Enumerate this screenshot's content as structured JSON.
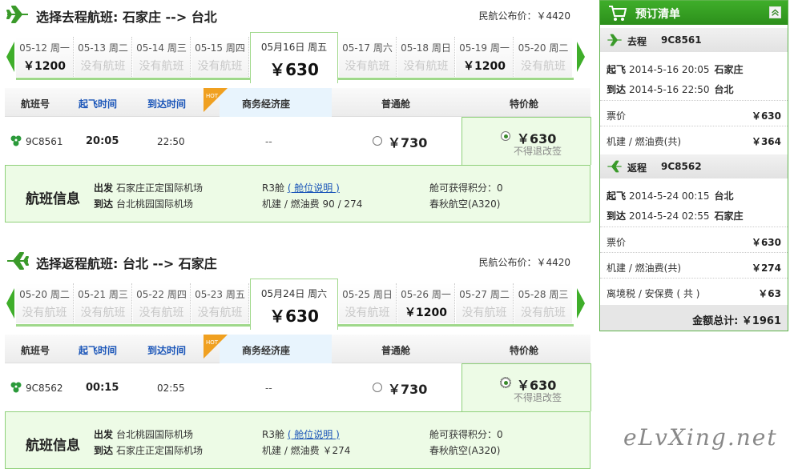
{
  "outbound": {
    "title": "选择去程航班: 石家庄 --> 台北",
    "public_price": "民航公布价：￥4420",
    "dates": [
      {
        "label": "05-12 周一",
        "price": "￥1200",
        "available": true
      },
      {
        "label": "05-13 周二",
        "price": "没有航班",
        "available": false
      },
      {
        "label": "05-14 周三",
        "price": "没有航班",
        "available": false
      },
      {
        "label": "05-15 周四",
        "price": "没有航班",
        "available": false
      },
      {
        "label": "05月16日 周五",
        "price": "￥630",
        "available": true,
        "selected": true
      },
      {
        "label": "05-17 周六",
        "price": "没有航班",
        "available": false
      },
      {
        "label": "05-18 周日",
        "price": "没有航班",
        "available": false
      },
      {
        "label": "05-19 周一",
        "price": "￥1200",
        "available": true
      },
      {
        "label": "05-20 周二",
        "price": "没有航班",
        "available": false
      }
    ],
    "headers": {
      "flight_no": "航班号",
      "dep_time": "起飞时间",
      "arr_time": "到达时间",
      "hot": "HOT",
      "business": "商务经济座",
      "economy": "普通舱",
      "special": "特价舱"
    },
    "flight": {
      "no": "9C8561",
      "dep": "20:05",
      "arr": "22:50",
      "business": "--",
      "economy_price": "￥730",
      "special_price": "￥630",
      "special_note": "不得退改签"
    },
    "info": {
      "title": "航班信息",
      "dep_label": "出发",
      "dep_airport": "石家庄正定国际机场",
      "arr_label": "到达",
      "arr_airport": "台北桃园国际机场",
      "cabin": "R3舱",
      "cabin_link": "( 舱位说明 )",
      "fees": "机建 / 燃油费 90 / 274",
      "points": "舱可获得积分：0",
      "carrier": "春秋航空(A320)"
    }
  },
  "return": {
    "title": "选择返程航班: 台北 --> 石家庄",
    "public_price": "民航公布价：￥4420",
    "dates": [
      {
        "label": "05-20 周二",
        "price": "没有航班",
        "available": false
      },
      {
        "label": "05-21 周三",
        "price": "没有航班",
        "available": false
      },
      {
        "label": "05-22 周四",
        "price": "没有航班",
        "available": false
      },
      {
        "label": "05-23 周五",
        "price": "没有航班",
        "available": false
      },
      {
        "label": "05月24日 周六",
        "price": "￥630",
        "available": true,
        "selected": true
      },
      {
        "label": "05-25 周日",
        "price": "没有航班",
        "available": false
      },
      {
        "label": "05-26 周一",
        "price": "￥1200",
        "available": true
      },
      {
        "label": "05-27 周二",
        "price": "没有航班",
        "available": false
      },
      {
        "label": "05-28 周三",
        "price": "没有航班",
        "available": false
      }
    ],
    "headers": {
      "flight_no": "航班号",
      "dep_time": "起飞时间",
      "arr_time": "到达时间",
      "hot": "HOT",
      "business": "商务经济座",
      "economy": "普通舱",
      "special": "特价舱"
    },
    "flight": {
      "no": "9C8562",
      "dep": "00:15",
      "arr": "02:55",
      "business": "--",
      "economy_price": "￥730",
      "special_price": "￥630",
      "special_note": "不得退改签"
    },
    "info": {
      "title": "航班信息",
      "dep_label": "出发",
      "dep_airport": "台北桃园国际机场",
      "arr_label": "到达",
      "arr_airport": "石家庄正定国际机场",
      "cabin": "R3舱",
      "cabin_link": "( 舱位说明 )",
      "fees": "机建 / 燃油费 ￥274",
      "points": "舱可获得积分：0",
      "carrier": "春秋航空(A320)"
    }
  },
  "sidebar": {
    "title": "预订清单",
    "go": {
      "label": "去程",
      "flight": "9C8561",
      "takeoff_label": "起飞",
      "takeoff_time": "2014-5-16 20:05",
      "takeoff_city": "石家庄",
      "arrive_label": "到达",
      "arrive_time": "2014-5-16 22:50",
      "arrive_city": "台北",
      "fare_label": "票价",
      "fare": "￥630",
      "tax_label": "机建 / 燃油费(共)",
      "tax": "￥364"
    },
    "back": {
      "label": "返程",
      "flight": "9C8562",
      "takeoff_label": "起飞",
      "takeoff_time": "2014-5-24 00:15",
      "takeoff_city": "台北",
      "arrive_label": "到达",
      "arrive_time": "2014-5-24 02:55",
      "arrive_city": "石家庄",
      "fare_label": "票价",
      "fare": "￥630",
      "tax_label": "机建 / 燃油费(共)",
      "tax": "￥274",
      "departure_tax_label": "离境税 / 安保费 ( 共 )",
      "departure_tax": "￥63"
    },
    "total": "金额总计: ￥1961"
  },
  "watermark": "eLvXing.net",
  "colors": {
    "accent_green": "#3fae2a",
    "panel_green": "#edfbe6",
    "link_blue": "#1a55b8",
    "hot_orange": "#f0a020"
  }
}
